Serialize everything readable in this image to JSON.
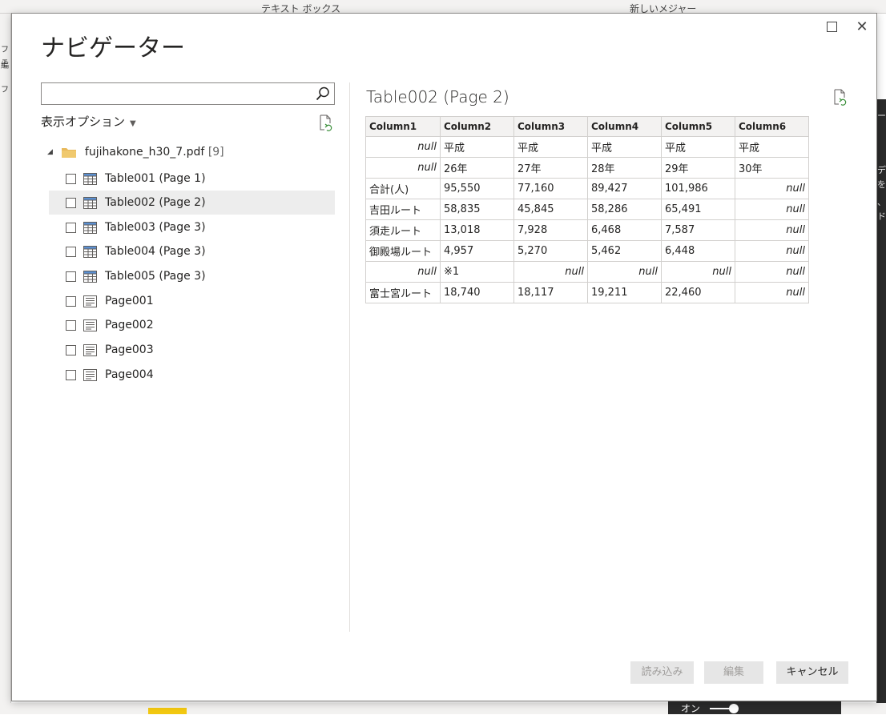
{
  "background": {
    "ribbon_items": [
      "テキスト ボックス",
      "新しいメジャー"
    ],
    "left_fragments": [
      "フェ",
      "編",
      "フ"
    ],
    "right_fragments": [
      "ー",
      "デ",
      "を",
      "、",
      "ド"
    ],
    "toggle_label": "オン"
  },
  "dialog": {
    "title": "ナビゲーター",
    "search": {
      "placeholder": "",
      "value": ""
    },
    "display_options_label": "表示オプション",
    "tree": {
      "root": {
        "name": "fujihakone_h30_7.pdf",
        "count": "[9]"
      },
      "items": [
        {
          "label": "Table001 (Page 1)",
          "kind": "table"
        },
        {
          "label": "Table002 (Page 2)",
          "kind": "table"
        },
        {
          "label": "Table003 (Page 3)",
          "kind": "table"
        },
        {
          "label": "Table004 (Page 3)",
          "kind": "table"
        },
        {
          "label": "Table005 (Page 3)",
          "kind": "table"
        },
        {
          "label": "Page001",
          "kind": "page"
        },
        {
          "label": "Page002",
          "kind": "page"
        },
        {
          "label": "Page003",
          "kind": "page"
        },
        {
          "label": "Page004",
          "kind": "page"
        }
      ]
    },
    "preview": {
      "title": "Table002 (Page 2)",
      "columns": [
        "Column1",
        "Column2",
        "Column3",
        "Column4",
        "Column5",
        "Column6"
      ],
      "rows": [
        [
          "null",
          "平成",
          "平成",
          "平成",
          "平成",
          "平成"
        ],
        [
          "null",
          "26年",
          "27年",
          "28年",
          "29年",
          "30年"
        ],
        [
          "合計(人)",
          "95,550",
          "77,160",
          "89,427",
          "101,986",
          "null"
        ],
        [
          "吉田ルート",
          "58,835",
          "45,845",
          "58,286",
          "65,491",
          "null"
        ],
        [
          "須走ルート",
          "13,018",
          "7,928",
          "6,468",
          "7,587",
          "null"
        ],
        [
          "御殿場ルート",
          "4,957",
          "5,270",
          "5,462",
          "6,448",
          "null"
        ],
        [
          "null",
          "※1",
          "null",
          "null",
          "null",
          "null"
        ],
        [
          "富士宮ルート",
          "18,740",
          "18,117",
          "19,211",
          "22,460",
          "null"
        ]
      ]
    },
    "buttons": {
      "load": "読み込み",
      "edit": "編集",
      "cancel": "キャンセル"
    }
  }
}
